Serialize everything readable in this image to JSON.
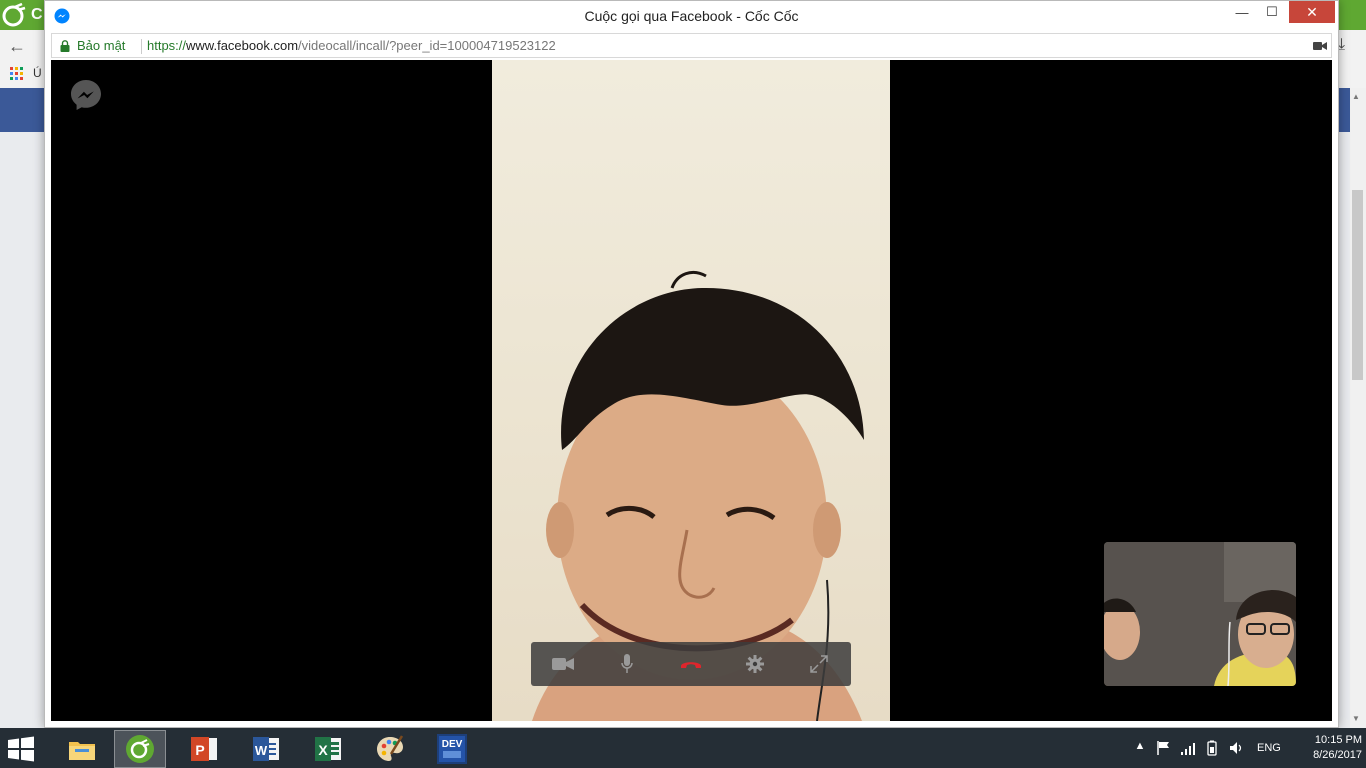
{
  "background_browser": {
    "logo_letter": "C",
    "bookmark_initial": "Ú",
    "accent_color": "#5fa832",
    "facebook_bar_color": "#3b5998"
  },
  "popup": {
    "title": "Cuộc gọi qua Facebook - Cốc Cốc",
    "window_controls": {
      "minimize": "—",
      "maximize": "☐",
      "close": "✕"
    },
    "address_bar": {
      "secure_label": "Bảo mật",
      "url_scheme": "https://",
      "url_host": "www.facebook.com",
      "url_path": "/videocall/incall/?peer_id=100004719523122"
    }
  },
  "call": {
    "controls": [
      {
        "name": "camera-toggle-button",
        "icon": "video-camera-icon"
      },
      {
        "name": "microphone-toggle-button",
        "icon": "microphone-icon"
      },
      {
        "name": "end-call-button",
        "icon": "hang-up-icon",
        "color": "#e0252c"
      },
      {
        "name": "settings-button",
        "icon": "gear-icon"
      },
      {
        "name": "fullscreen-button",
        "icon": "expand-icon"
      }
    ]
  },
  "taskbar": {
    "pinned": [
      {
        "name": "file-explorer",
        "icon": "folder-icon"
      },
      {
        "name": "coc-coc-browser",
        "icon": "coccoc-icon",
        "active": true
      },
      {
        "name": "powerpoint",
        "icon": "powerpoint-icon",
        "letter": "P"
      },
      {
        "name": "word",
        "icon": "word-icon",
        "letter": "W"
      },
      {
        "name": "excel",
        "icon": "excel-icon",
        "letter": "X"
      },
      {
        "name": "paint",
        "icon": "palette-icon"
      },
      {
        "name": "dev-cpp",
        "icon": "devcpp-icon",
        "letter": "DEV"
      }
    ],
    "language": "ENG",
    "time": "10:15 PM",
    "date": "8/26/2017"
  }
}
